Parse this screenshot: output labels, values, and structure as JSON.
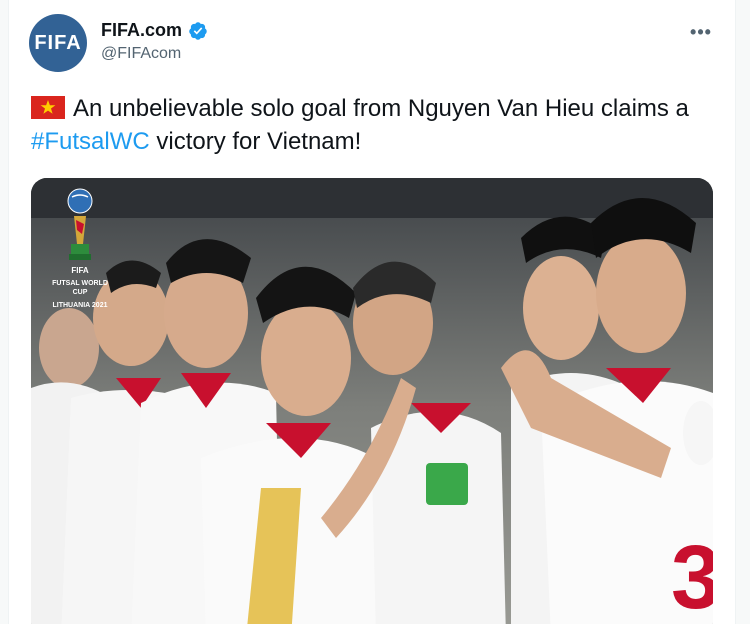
{
  "account": {
    "avatar_text": "FIFA",
    "display_name": "FIFA.com",
    "handle": "@FIFAcom",
    "verified": true
  },
  "tweet": {
    "text_before": "An unbelievable solo goal from Nguyen Van Hieu claims a ",
    "hashtag": "#FutsalWC",
    "text_after": " victory for Vietnam!",
    "flag": "vietnam-flag"
  },
  "media": {
    "logo_caption_line1": "FUTSAL WORLD CUP",
    "logo_caption_line2": "LITHUANIA 2021",
    "logo_badge": "FIFA"
  },
  "icons": {
    "verified": "verified-badge-icon",
    "more": "more-options-icon"
  },
  "colors": {
    "brand_blue": "#1d9bf0",
    "fifa_blue": "#326295",
    "jersey_red": "#c8102e"
  }
}
